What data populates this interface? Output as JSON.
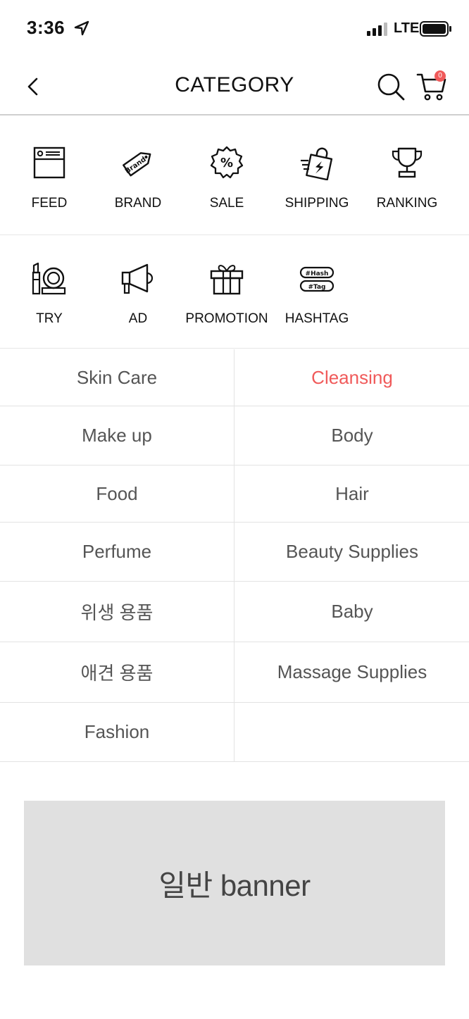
{
  "status_bar": {
    "time": "3:36",
    "network": "LTE",
    "icons": [
      "location-arrow-icon",
      "signal-icon",
      "battery-icon"
    ]
  },
  "header": {
    "title": "CATEGORY",
    "cart_count": "0",
    "icons": [
      "back-chevron-icon",
      "search-icon",
      "cart-icon"
    ]
  },
  "quick_menu": {
    "row1": [
      {
        "label": "FEED",
        "icon": "feed-icon"
      },
      {
        "label": "BRAND",
        "icon": "brand-tag-icon",
        "icon_text": "Brand"
      },
      {
        "label": "SALE",
        "icon": "sale-percent-icon",
        "icon_text": "%"
      },
      {
        "label": "SHIPPING",
        "icon": "shipping-bag-icon"
      },
      {
        "label": "RANKING",
        "icon": "trophy-icon"
      }
    ],
    "row2": [
      {
        "label": "TRY",
        "icon": "cosmetics-icon"
      },
      {
        "label": "AD",
        "icon": "megaphone-icon"
      },
      {
        "label": "PROMOTION",
        "icon": "gift-icon"
      },
      {
        "label": "HASHTAG",
        "icon": "hashtag-icon",
        "icon_text": [
          "#Hash",
          "#Tag"
        ]
      }
    ]
  },
  "categories": [
    [
      "Skin Care",
      "Cleansing"
    ],
    [
      "Make up",
      "Body"
    ],
    [
      "Food",
      "Hair"
    ],
    [
      "Perfume",
      "Beauty Supplies"
    ],
    [
      "위생 용품",
      "Baby"
    ],
    [
      "애견 용품",
      "Massage Supplies"
    ],
    [
      "Fashion",
      ""
    ]
  ],
  "selected_category": "Cleansing",
  "banner": {
    "text": "일반 banner"
  },
  "colors": {
    "accent": "#f05a5a",
    "banner_bg": "#e0e0e0",
    "divider": "#e3e3e3"
  }
}
